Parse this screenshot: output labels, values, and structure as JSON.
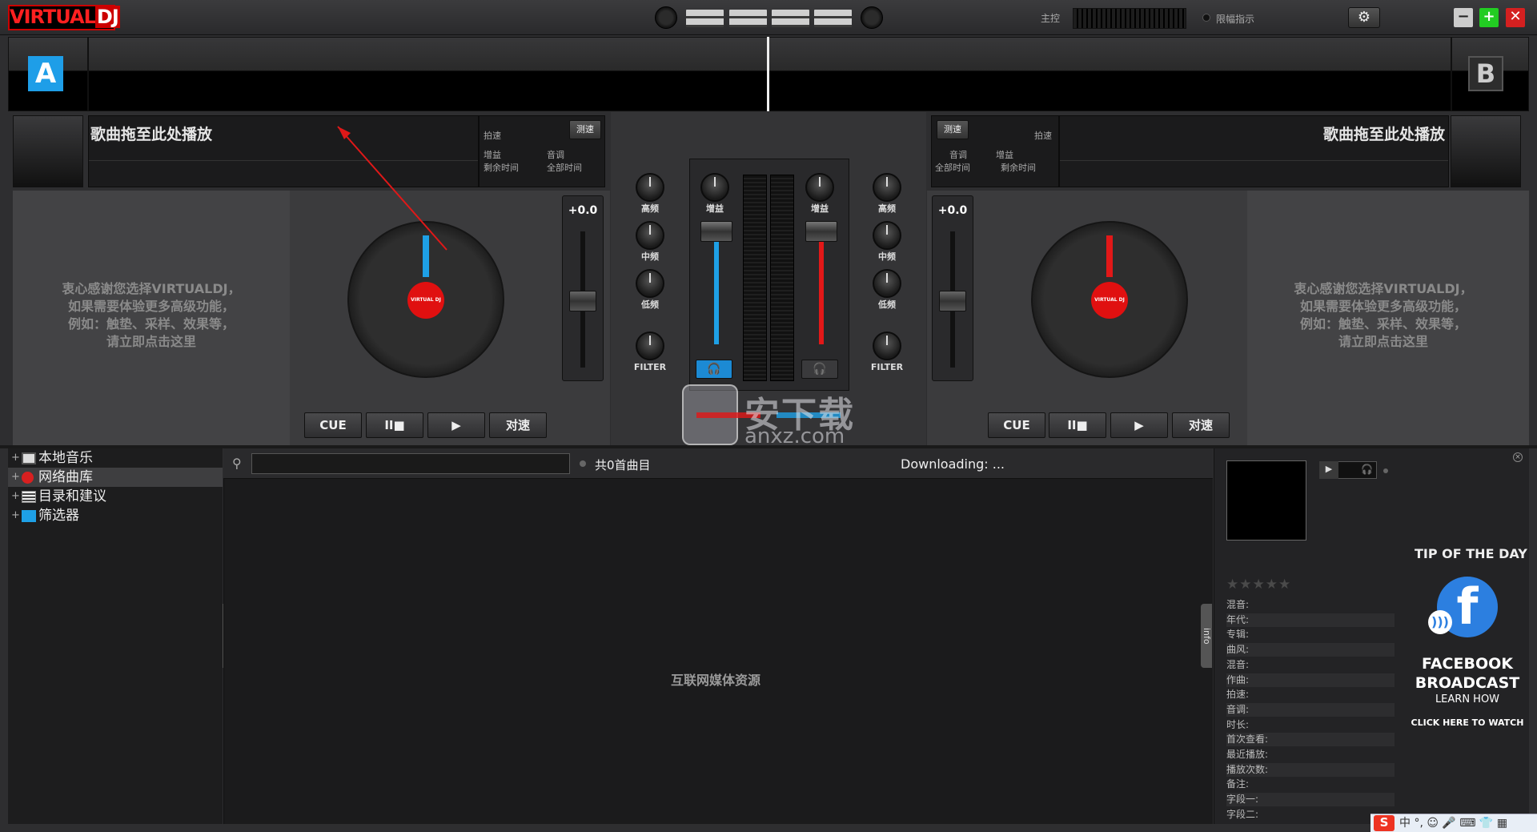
{
  "app": {
    "logo_a": "VIRTUAL",
    "logo_b": "DJ"
  },
  "header": {
    "master_label": "主控",
    "limiter_label": "限幅指示",
    "settings_icon": "gear-icon"
  },
  "window": {
    "minimize": "−",
    "maximize": "+",
    "close": "✕"
  },
  "deckA": {
    "letter": "A",
    "title": "歌曲拖至此处播放",
    "bpm_label": "拍速",
    "sync_button": "测速",
    "gain_label": "增益",
    "key_label": "音调",
    "remain_label": "剩余时间",
    "total_label": "全部时间",
    "pitch_value": "+0.0",
    "promo": [
      "衷心感谢您选择VIRTUALDJ，",
      "如果需要体验更多高级功能，",
      "例如：触垫、采样、效果等，",
      "请立即点击这里"
    ],
    "platter_label": "VIRTUAL DJ",
    "buttons": {
      "cue": "CUE",
      "pause": "II■",
      "play": "▶",
      "sync": "对速"
    },
    "accent": "#1ea0e6"
  },
  "deckB": {
    "letter": "B",
    "title": "歌曲拖至此处播放",
    "bpm_label": "拍速",
    "sync_button": "测速",
    "gain_label": "增益",
    "key_label": "音调",
    "remain_label": "剩余时间",
    "total_label": "全部时间",
    "pitch_value": "+0.0",
    "promo": [
      "衷心感谢您选择VIRTUALDJ，",
      "如果需要体验更多高级功能，",
      "例如：触垫、采样、效果等，",
      "请立即点击这里"
    ],
    "platter_label": "VIRTUAL DJ",
    "buttons": {
      "cue": "CUE",
      "pause": "II■",
      "play": "▶",
      "sync": "对速"
    },
    "accent": "#e21818"
  },
  "mixer": {
    "high": "高频",
    "mid": "中频",
    "low": "低频",
    "filter": "FILTER",
    "gain": "增益",
    "headphone_icon": "headphone-icon"
  },
  "watermark": {
    "main": "安下载",
    "sub": "anxz.com"
  },
  "browser": {
    "tree": [
      {
        "label": "本地音乐",
        "icon": "computer-icon"
      },
      {
        "label": "网络曲库",
        "icon": "globe-icon"
      },
      {
        "label": "目录和建议",
        "icon": "list-icon"
      },
      {
        "label": "筛选器",
        "icon": "filter-icon"
      }
    ],
    "folders_tab": "folders",
    "info_tab": "info",
    "search_placeholder": "",
    "count": "共0首曲目",
    "status": "Downloading: ...",
    "empty_message": "互联网媒体资源"
  },
  "info": {
    "tip_title": "TIP OF THE DAY",
    "fb_letter": "f",
    "fb_line1": "FACEBOOK",
    "fb_line2": "BROADCAST",
    "fb_line3": "LEARN HOW",
    "fb_line4": "CLICK HERE TO WATCH",
    "stars": "★★★★★",
    "fields": [
      "混音:",
      "年代:",
      "专辑:",
      "曲风:",
      "混音:",
      "作曲:",
      "拍速:",
      "音调:",
      "时长:",
      "首次查看:",
      "最近播放:",
      "播放次数:",
      "备注:",
      "字段一:",
      "字段二:"
    ]
  },
  "taskbar": {
    "ime_logo": "S",
    "ime_text": "中 °, ☺ 🎤 ⌨ 👕 ▦"
  }
}
